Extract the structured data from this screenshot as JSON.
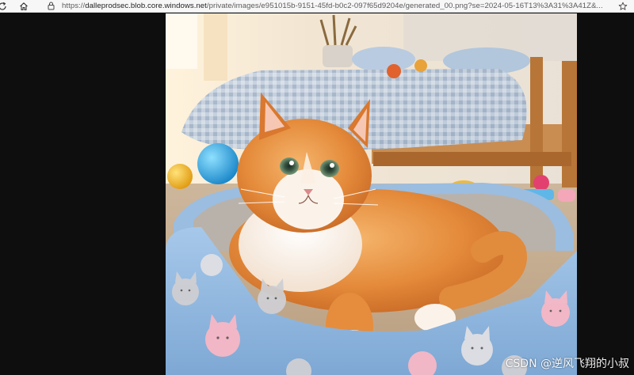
{
  "browser": {
    "url_scheme": "https://",
    "url_host": "dalleprodsec.blob.core.windows.net",
    "url_path": "/private/images/e951015b-9151-45fd-b0c2-097f65d9204e/generated_00.png?se=2024-05-16T13%3A31%3A41Z&...",
    "icons": {
      "reload": "reload-icon",
      "home": "home-icon",
      "site_info": "site-info-icon",
      "favorite": "favorite-star-icon"
    }
  },
  "image": {
    "subject_icons": [
      "cat",
      "cat-bed",
      "bed",
      "toy-balls"
    ]
  },
  "watermark": {
    "text": "CSDN @逆风飞翔的小叔"
  },
  "colors": {
    "toolbar_bg": "#f7f7f7",
    "viewer_bg": "#0e0e0e",
    "cat_fur": "#e8923f",
    "bed_blue": "#8fb8e0"
  }
}
